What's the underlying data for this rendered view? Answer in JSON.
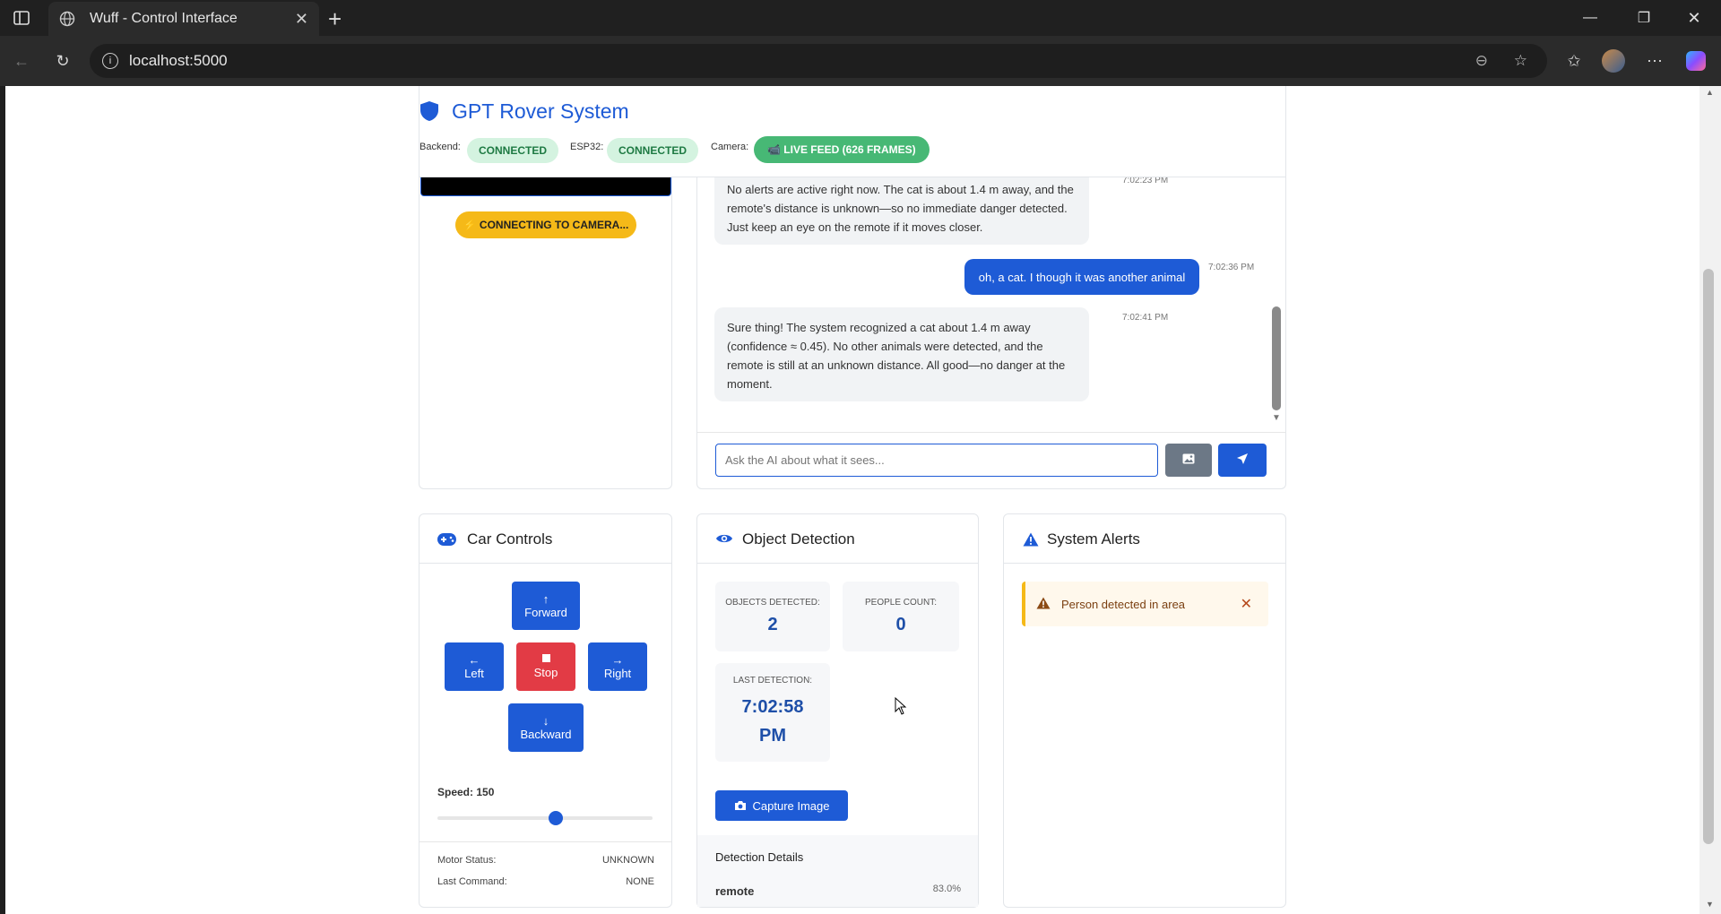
{
  "browser": {
    "tab_title": "Wuff - Control Interface",
    "url": "localhost:5000"
  },
  "header": {
    "title": "GPT Rover System",
    "backend_label": "Backend:",
    "backend_status": "CONNECTED",
    "esp_label": "ESP32:",
    "esp_status": "CONNECTED",
    "camera_label": "Camera:",
    "camera_status": "📹 LIVE FEED (626 FRAMES)"
  },
  "camera": {
    "status_badge": "⚡ CONNECTING TO CAMERA..."
  },
  "chat": {
    "messages": [
      {
        "role": "ai",
        "text": "No alerts are active right now. The cat is about 1.4 m away, and the remote's distance is unknown—so no immediate danger detected. Just keep an eye on the remote if it moves closer.",
        "time": "7:02:23 PM"
      },
      {
        "role": "user",
        "text": "oh, a cat. I though it was another animal",
        "time": "7:02:36 PM"
      },
      {
        "role": "ai",
        "text": "Sure thing! The system recognized a cat about 1.4 m away (confidence ≈ 0.45). No other animals were detected, and the remote is still at an unknown distance. All good—no danger at the moment.",
        "time": "7:02:41 PM"
      }
    ],
    "placeholder": "Ask the AI about what it sees..."
  },
  "controls": {
    "title": "Car Controls",
    "forward": "Forward",
    "left": "Left",
    "stop": "Stop",
    "right": "Right",
    "backward": "Backward",
    "speed_label": "Speed: 150",
    "speed_value": 150,
    "speed_max": 255,
    "motor_status_label": "Motor Status:",
    "motor_status": "UNKNOWN",
    "last_command_label": "Last Command:",
    "last_command": "NONE"
  },
  "detection": {
    "title": "Object Detection",
    "objects_label": "OBJECTS DETECTED:",
    "objects_value": "2",
    "people_label": "PEOPLE COUNT:",
    "people_value": "0",
    "last_label": "LAST DETECTION:",
    "last_value": "7:02:58 PM",
    "capture": "Capture Image",
    "details_title": "Detection Details",
    "detail_name": "remote",
    "detail_conf": "83.0%"
  },
  "alerts": {
    "title": "System Alerts",
    "items": [
      {
        "text": "Person detected in area"
      }
    ]
  },
  "colors": {
    "primary": "#1e5bd6",
    "danger": "#e23b45",
    "warning": "#f5b918",
    "success": "#47b875"
  }
}
